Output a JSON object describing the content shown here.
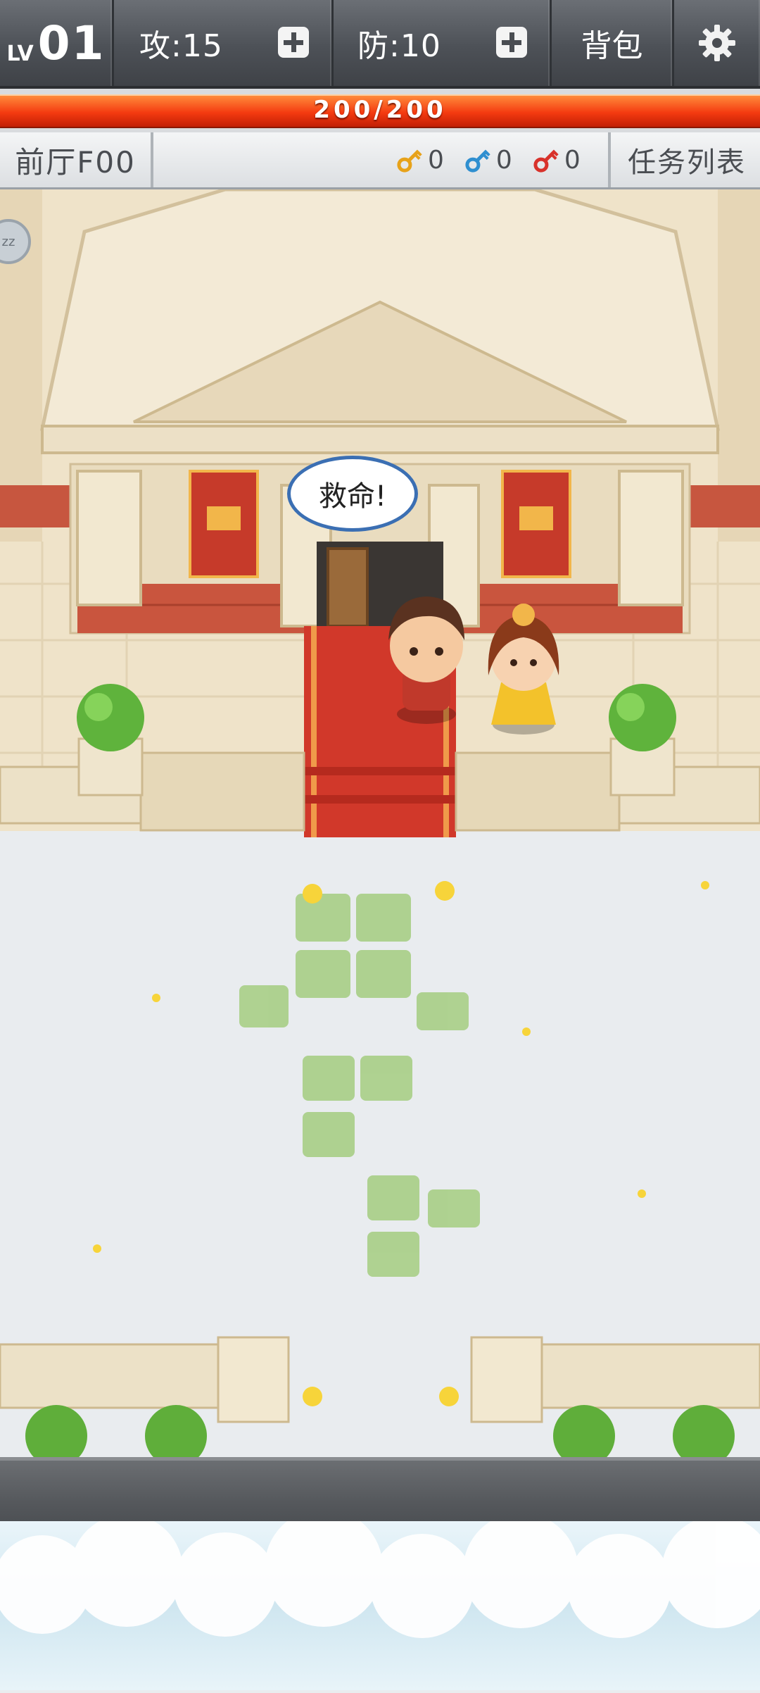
{
  "header": {
    "level_prefix": "LV",
    "level": "01",
    "attack": "攻:15",
    "defense": "防:10",
    "bag": "背包"
  },
  "hp": {
    "text": "200/200",
    "fill_fraction": 1.0
  },
  "info": {
    "floor": "前厅F00",
    "keys": [
      {
        "color": "#e7a21a",
        "count": "0"
      },
      {
        "color": "#2f8fd0",
        "count": "0"
      },
      {
        "color": "#d8322b",
        "count": "0"
      }
    ],
    "task_list": "任务列表"
  },
  "scene": {
    "speech": "救命!",
    "sleep_badge": "zz"
  },
  "icons": {
    "settings": "gear-icon",
    "add": "plus-icon",
    "key": "key-icon"
  }
}
